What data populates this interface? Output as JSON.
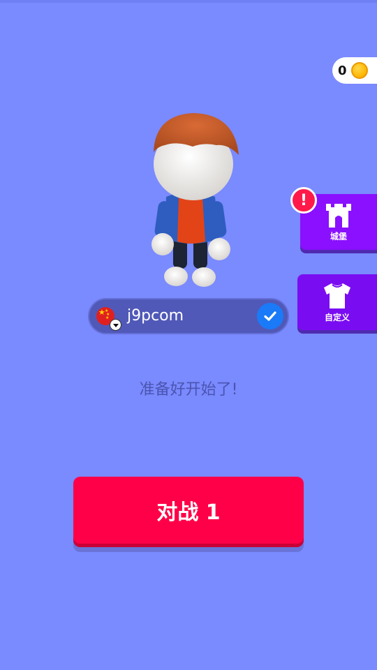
{
  "coins": {
    "count": "0",
    "icon": "coin-icon"
  },
  "player": {
    "name": "j9pcom",
    "flag_icon": "china-flag-icon"
  },
  "side_menu": {
    "castle_label": "城堡",
    "customize_label": "自定义",
    "alert_symbol": "!"
  },
  "status": {
    "ready_text": "准备好开始了!"
  },
  "battle": {
    "label": "对战 1"
  },
  "colors": {
    "background": "#7a8aff",
    "battle_button": "#ff0048",
    "side_button": "#8a10ff",
    "name_bar": "#5059b8",
    "confirm_button": "#1a7af8",
    "alert_badge": "#ff1a4a"
  }
}
